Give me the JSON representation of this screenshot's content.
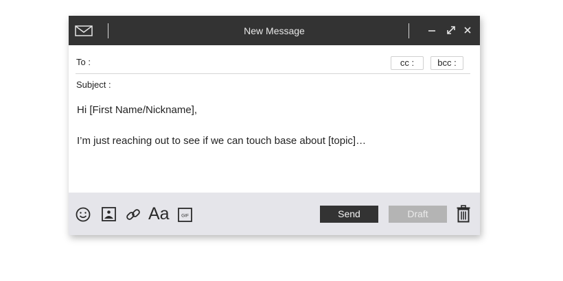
{
  "window": {
    "title": "New Message"
  },
  "fields": {
    "to_label": "To :",
    "cc_label": "cc :",
    "bcc_label": "bcc :",
    "subject_label": "Subject :"
  },
  "message": {
    "greeting": "Hi [First Name/Nickname],",
    "body": "I’m just reaching out to see if we can touch base about [topic]…"
  },
  "toolbar": {
    "font_label": "Aa",
    "gif_label": "GIF",
    "send_label": "Send",
    "draft_label": "Draft"
  },
  "icons": [
    "mail-icon",
    "minimize-icon",
    "expand-icon",
    "close-icon",
    "emoji-icon",
    "image-icon",
    "link-icon",
    "font-icon",
    "gif-icon",
    "trash-icon"
  ],
  "colors": {
    "titlebar": "#333333",
    "toolbar": "#e5e5ea",
    "send_button": "#333333",
    "draft_button": "#b4b4b4"
  }
}
